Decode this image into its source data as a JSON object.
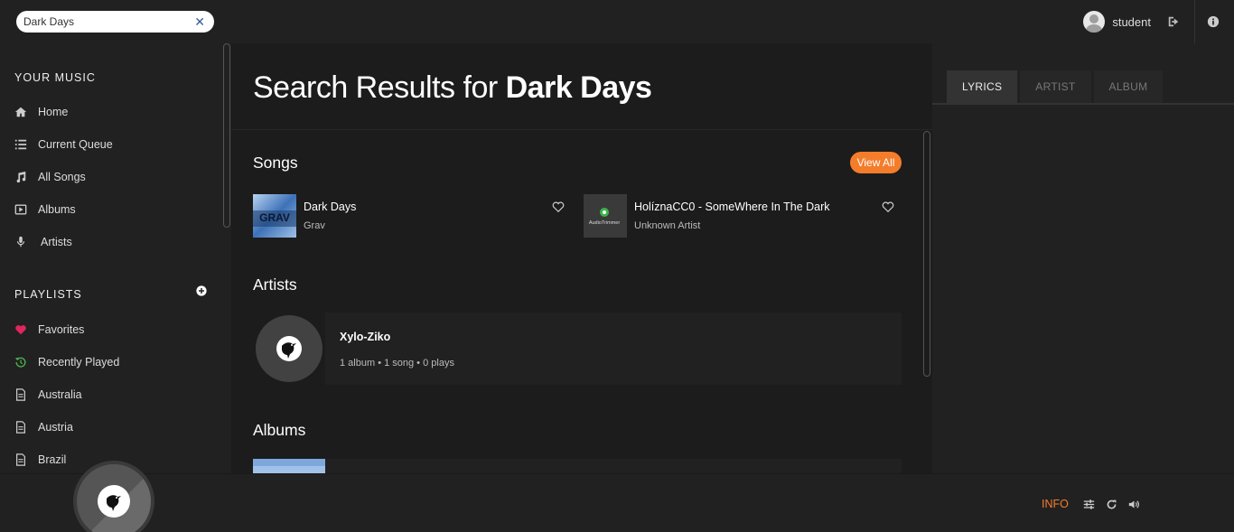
{
  "search": {
    "value": "Dark Days",
    "clear_symbol": "✕"
  },
  "user": {
    "name": "student"
  },
  "sidebar": {
    "your_music_heading": "YOUR MUSIC",
    "music_items": [
      {
        "label": "Home",
        "icon": "home-icon"
      },
      {
        "label": "Current Queue",
        "icon": "queue-icon"
      },
      {
        "label": "All Songs",
        "icon": "music-note-icon"
      },
      {
        "label": "Albums",
        "icon": "album-icon"
      },
      {
        "label": "Artists",
        "icon": "microphone-icon"
      }
    ],
    "playlists_heading": "PLAYLISTS",
    "playlist_items": [
      {
        "label": "Favorites",
        "icon": "heart-icon",
        "color": "#e0265e"
      },
      {
        "label": "Recently Played",
        "icon": "history-icon",
        "color": "#4caf50"
      },
      {
        "label": "Australia",
        "icon": "file-icon"
      },
      {
        "label": "Austria",
        "icon": "file-icon"
      },
      {
        "label": "Brazil",
        "icon": "file-icon"
      }
    ]
  },
  "main": {
    "title_prefix": "Search Results for ",
    "title_query": "Dark Days",
    "songs_heading": "Songs",
    "view_all_label": "View All",
    "songs": [
      {
        "title": "Dark Days",
        "artist": "Grav",
        "cover_text": "GRAV"
      },
      {
        "title": "HolíznaCC0 - SomeWhere In The Dark",
        "artist": "Unknown Artist",
        "cover_text": "AudioTrimmer"
      }
    ],
    "artists_heading": "Artists",
    "artist": {
      "name": "Xylo-Ziko",
      "meta": "1 album • 1 song • 0 plays"
    },
    "albums_heading": "Albums"
  },
  "right_panel": {
    "tabs": [
      {
        "label": "LYRICS",
        "active": true
      },
      {
        "label": "ARTIST",
        "active": false
      },
      {
        "label": "ALBUM",
        "active": false
      }
    ]
  },
  "player": {
    "info_label": "INFO"
  },
  "colors": {
    "accent": "#f47d2b",
    "background": "#212121",
    "content": "#1c1c1c"
  }
}
